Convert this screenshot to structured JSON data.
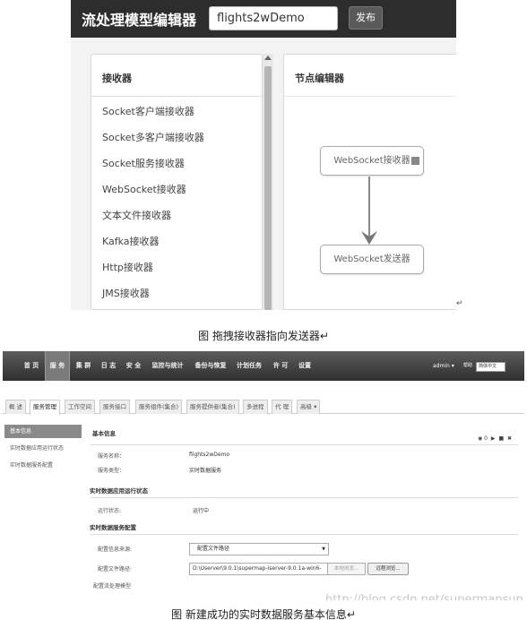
{
  "figure1": {
    "app_title": "流处理模型编辑器",
    "model_name": "flights2wDemo",
    "publish_label": "发布",
    "receivers_title": "接收器",
    "receivers": [
      "Socket客户端接收器",
      "Socket多客户端接收器",
      "Socket服务接收器",
      "WebSocket接收器",
      "文本文件接收器",
      "Kafka接收器",
      "Http接收器",
      "JMS接收器"
    ],
    "editor_title": "节点编辑器",
    "node_source": "WebSocket接收器",
    "node_target": "WebSocket发送器",
    "paragraph_mark": "↵",
    "caption": "图  拖拽接收器指向发送器↵"
  },
  "figure2": {
    "nav_items": [
      "首 页",
      "服 务",
      "集 群",
      "日 志",
      "安 全",
      "监控与统计",
      "备份与恢复",
      "计划任务",
      "许 可",
      "设置"
    ],
    "active_nav": 1,
    "admin_label": "admin ▾",
    "help_label": "帮助",
    "language": "简体中文",
    "tabs": [
      "概 述",
      "服务管理",
      "工作空间",
      "服务接口",
      "服务组件(集合)",
      "服务提供者(集合)",
      "多进程",
      "代 理",
      "高级 ▾"
    ],
    "active_tab": 1,
    "side_nav": [
      "基本信息",
      "实时数据应用运行状态",
      "实时数据服务配置"
    ],
    "active_side": 0,
    "basic_info_title": "基本信息",
    "panel_tools": [
      "◉ 0",
      "▶",
      "■",
      "✖"
    ],
    "service_name_label": "服务名称：",
    "service_name_value": "flights2wDemo",
    "service_type_label": "服务类型：",
    "service_type_value": "实时数据服务",
    "runtime_title": "实时数据应用运行状态",
    "run_status_label": "运行状态:",
    "run_status_value": "运行中",
    "config_title": "实时数据服务配置",
    "config_source_label": "配置信息来源:",
    "config_source_value": "配置文件路径",
    "config_file_label": "配置文件路径:",
    "config_file_value": "D:\\Userver\\9.0.1\\supermap-iserver-9.0.1a-win6-",
    "local_browse_label": "本地浏览...",
    "remote_browse_label": "远程浏览...",
    "stream_model_label": "配置流处理模型",
    "watermark": "http://blog.csdn.net/supermapsupport",
    "caption": "图  新建成功的实时数据服务基本信息↵"
  }
}
